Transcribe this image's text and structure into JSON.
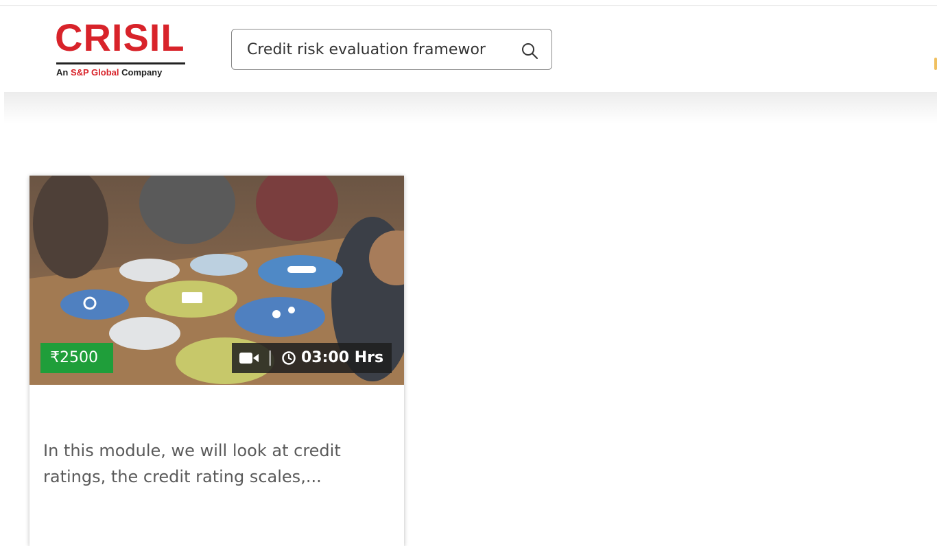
{
  "brand": {
    "logo_text": "CRISIL",
    "tagline_prefix": "An ",
    "tagline_brand": "S&P Global",
    "tagline_suffix": " Company",
    "color": "#d8232a"
  },
  "search": {
    "value": "Credit risk evaluation framewor",
    "icon": "search-icon"
  },
  "course_card": {
    "price": "₹2500",
    "media_icon": "video-camera-icon",
    "separator": "|",
    "duration_icon": "clock-icon",
    "duration": "03:00 Hrs",
    "description": "In this module, we will look at credit ratings, the credit rating scales,...",
    "price_color": "#1f9e3a"
  }
}
